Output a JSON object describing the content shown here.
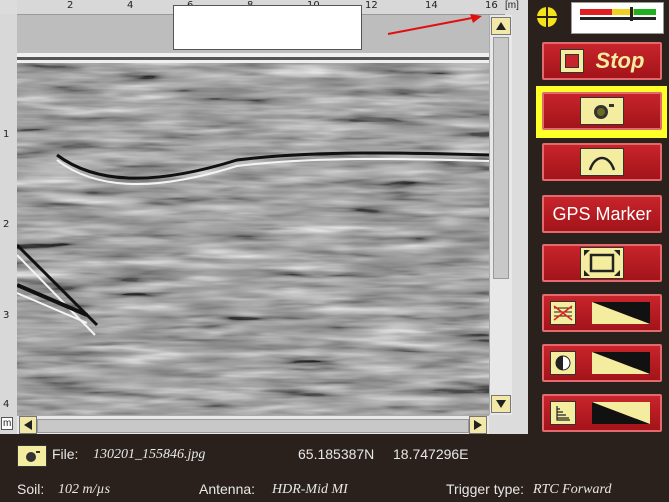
{
  "radar": {
    "top_ruler_ticks": [
      "2",
      "4",
      "6",
      "8",
      "10",
      "12",
      "14",
      "16"
    ],
    "left_ruler_ticks": [
      "1",
      "2",
      "3",
      "4"
    ],
    "unit_label": "[m]",
    "unit_label_bottom": "m"
  },
  "right_panel": {
    "stop_label": "Stop",
    "gps_marker_label": "GPS Marker"
  },
  "status": {
    "file_label": "File:",
    "file_name": "130201_155846.jpg",
    "latitude": "65.185387N",
    "longitude": "18.747296E",
    "soil_label": "Soil:",
    "soil_value": "102 m/µs",
    "antenna_label": "Antenna:",
    "antenna_value": "HDR-Mid MI",
    "trigger_label": "Trigger type:",
    "trigger_value": "RTC Forward"
  },
  "colors": {
    "button_red": "#c8242b",
    "highlight_yellow": "#ffff2a",
    "icon_yellow": "#f4ec9e",
    "background_dark": "#2a211c"
  }
}
